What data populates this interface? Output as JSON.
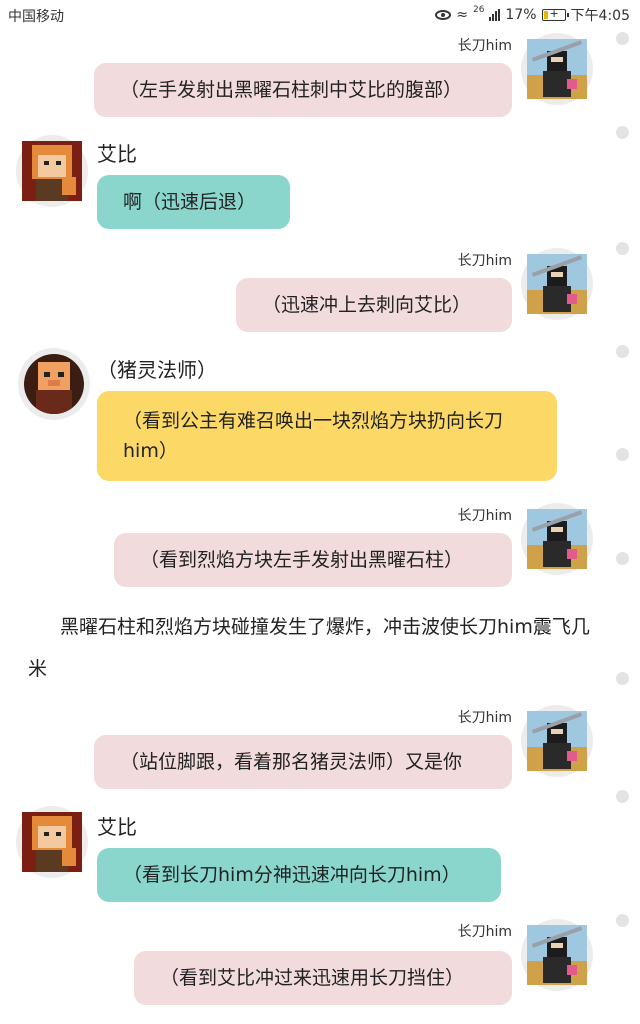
{
  "status_bar": {
    "carrier": "中国移动",
    "network": "26",
    "battery": "17%",
    "time": "下午4:05"
  },
  "messages": [
    {
      "sender": "长刀him",
      "side": "right",
      "color": "pink",
      "text": "（左手发射出黑曜石柱刺中艾比的腹部）"
    },
    {
      "sender": "艾比",
      "side": "left",
      "color": "teal",
      "text": "啊（迅速后退）"
    },
    {
      "sender": "长刀him",
      "side": "right",
      "color": "pink",
      "text": "（迅速冲上去刺向艾比）"
    },
    {
      "sender": "（猪灵法师）",
      "side": "left",
      "color": "yellow",
      "text": "（看到公主有难召唤出一块烈焰方块扔向长刀him）"
    },
    {
      "sender": "长刀him",
      "side": "right",
      "color": "pink",
      "text": "（看到烈焰方块左手发射出黑曜石柱）"
    },
    {
      "sender": "长刀him",
      "side": "right",
      "color": "pink",
      "text": "（站位脚跟，看着那名猪灵法师）又是你"
    },
    {
      "sender": "艾比",
      "side": "left",
      "color": "teal",
      "text": "（看到长刀him分神迅速冲向长刀him）"
    },
    {
      "sender": "长刀him",
      "side": "right",
      "color": "pink",
      "text": "（看到艾比冲过来迅速用长刀挡住）"
    }
  ],
  "narration": "黑曜石柱和烈焰方块碰撞发生了爆炸，冲击波使长刀him震飞几米",
  "colors": {
    "bubble_pink": "#f2dbdc",
    "bubble_teal": "#8ad6cd",
    "bubble_yellow": "#fcd966"
  }
}
